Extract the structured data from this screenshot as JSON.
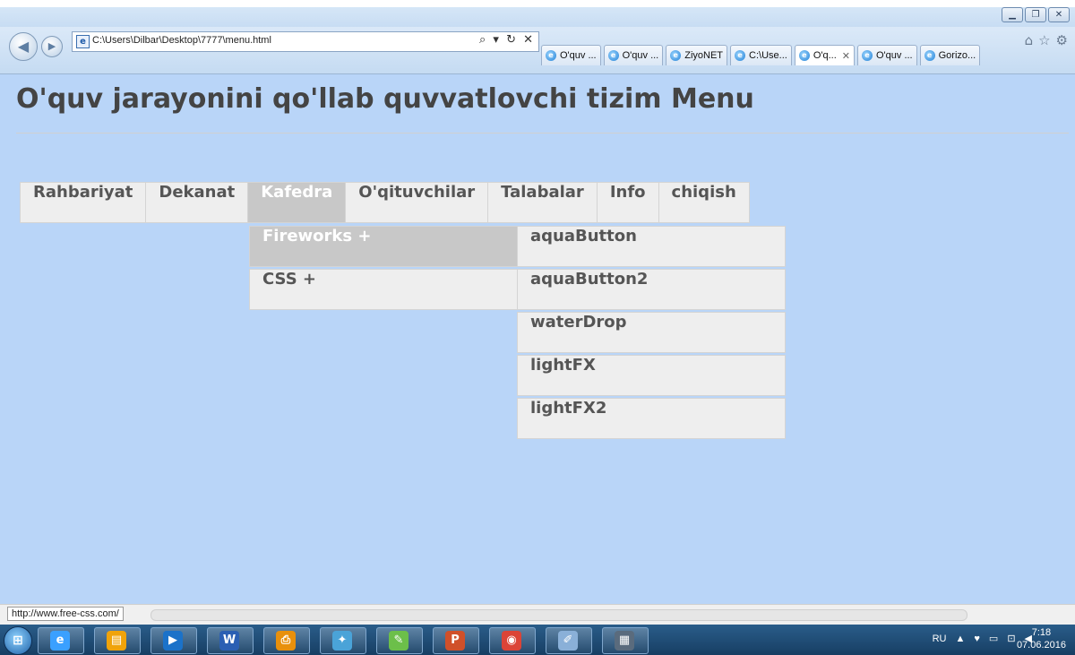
{
  "browser": {
    "address_url": "C:\\Users\\Dilbar\\Desktop\\7777\\menu.html",
    "address_tools": "⌕ ▾ ↻ ✕",
    "tabs": [
      {
        "label": "O'quv ...",
        "active": false,
        "closable": false
      },
      {
        "label": "O'quv ...",
        "active": false,
        "closable": false
      },
      {
        "label": "ZiyoNET",
        "active": false,
        "closable": false
      },
      {
        "label": "C:\\Use...",
        "active": false,
        "closable": false
      },
      {
        "label": "O'q...",
        "active": true,
        "closable": true
      },
      {
        "label": "O'quv ...",
        "active": false,
        "closable": false
      },
      {
        "label": "Gorizo...",
        "active": false,
        "closable": false
      }
    ],
    "right_icons": [
      "home-icon",
      "star-icon",
      "gear-icon"
    ]
  },
  "page": {
    "title": "O'quv jarayonini qo'llab quvvatlovchi tizim Menu"
  },
  "menu": {
    "items": [
      "Rahbariyat",
      "Dekanat",
      "Kafedra",
      "O'qituvchilar",
      "Talabalar",
      "Info",
      "chiqish"
    ],
    "active": "Kafedra",
    "submenu": [
      "Fireworks +",
      "CSS +"
    ],
    "submenu_active": "Fireworks +",
    "subsubmenu": [
      "aquaButton",
      "aquaButton2",
      "waterDrop",
      "lightFX",
      "lightFX2"
    ]
  },
  "status": {
    "url": "http://www.free-css.com/"
  },
  "taskbar": {
    "apps": [
      "internet-explorer-icon",
      "file-explorer-icon",
      "media-player-icon",
      "word-icon",
      "pdf-icon",
      "app-icon",
      "notes-icon",
      "powerpoint-icon",
      "chrome-icon",
      "paint-icon",
      "calculator-icon"
    ],
    "lang": "RU",
    "time": "7:18",
    "date": "07.06.2016"
  },
  "colors": {
    "page_bg": "#b9d5f8",
    "menu_bg": "#eeeeee",
    "menu_active_bg": "#c8c8c8",
    "menu_text": "#555555",
    "title_text": "#444444"
  }
}
